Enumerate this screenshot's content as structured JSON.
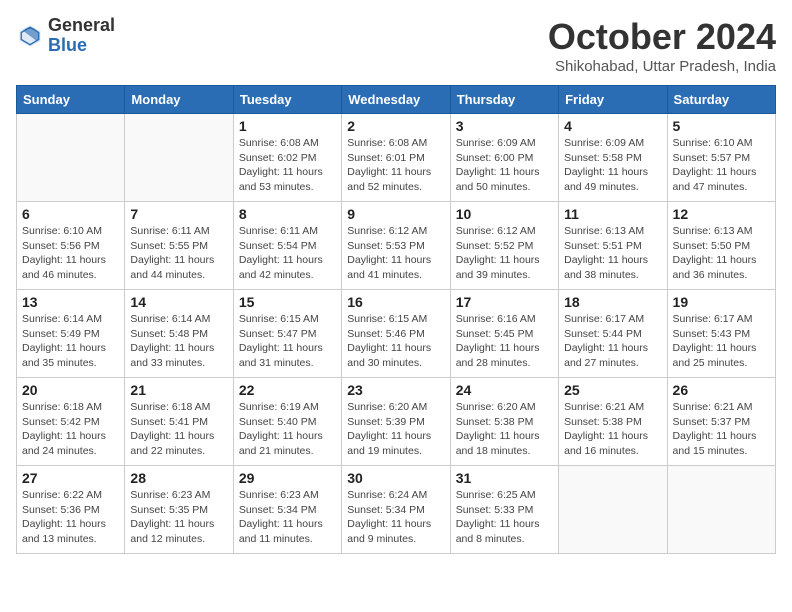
{
  "header": {
    "logo_general": "General",
    "logo_blue": "Blue",
    "month_title": "October 2024",
    "subtitle": "Shikohabad, Uttar Pradesh, India"
  },
  "days_of_week": [
    "Sunday",
    "Monday",
    "Tuesday",
    "Wednesday",
    "Thursday",
    "Friday",
    "Saturday"
  ],
  "weeks": [
    [
      {
        "day": "",
        "info": ""
      },
      {
        "day": "",
        "info": ""
      },
      {
        "day": "1",
        "info": "Sunrise: 6:08 AM\nSunset: 6:02 PM\nDaylight: 11 hours and 53 minutes."
      },
      {
        "day": "2",
        "info": "Sunrise: 6:08 AM\nSunset: 6:01 PM\nDaylight: 11 hours and 52 minutes."
      },
      {
        "day": "3",
        "info": "Sunrise: 6:09 AM\nSunset: 6:00 PM\nDaylight: 11 hours and 50 minutes."
      },
      {
        "day": "4",
        "info": "Sunrise: 6:09 AM\nSunset: 5:58 PM\nDaylight: 11 hours and 49 minutes."
      },
      {
        "day": "5",
        "info": "Sunrise: 6:10 AM\nSunset: 5:57 PM\nDaylight: 11 hours and 47 minutes."
      }
    ],
    [
      {
        "day": "6",
        "info": "Sunrise: 6:10 AM\nSunset: 5:56 PM\nDaylight: 11 hours and 46 minutes."
      },
      {
        "day": "7",
        "info": "Sunrise: 6:11 AM\nSunset: 5:55 PM\nDaylight: 11 hours and 44 minutes."
      },
      {
        "day": "8",
        "info": "Sunrise: 6:11 AM\nSunset: 5:54 PM\nDaylight: 11 hours and 42 minutes."
      },
      {
        "day": "9",
        "info": "Sunrise: 6:12 AM\nSunset: 5:53 PM\nDaylight: 11 hours and 41 minutes."
      },
      {
        "day": "10",
        "info": "Sunrise: 6:12 AM\nSunset: 5:52 PM\nDaylight: 11 hours and 39 minutes."
      },
      {
        "day": "11",
        "info": "Sunrise: 6:13 AM\nSunset: 5:51 PM\nDaylight: 11 hours and 38 minutes."
      },
      {
        "day": "12",
        "info": "Sunrise: 6:13 AM\nSunset: 5:50 PM\nDaylight: 11 hours and 36 minutes."
      }
    ],
    [
      {
        "day": "13",
        "info": "Sunrise: 6:14 AM\nSunset: 5:49 PM\nDaylight: 11 hours and 35 minutes."
      },
      {
        "day": "14",
        "info": "Sunrise: 6:14 AM\nSunset: 5:48 PM\nDaylight: 11 hours and 33 minutes."
      },
      {
        "day": "15",
        "info": "Sunrise: 6:15 AM\nSunset: 5:47 PM\nDaylight: 11 hours and 31 minutes."
      },
      {
        "day": "16",
        "info": "Sunrise: 6:15 AM\nSunset: 5:46 PM\nDaylight: 11 hours and 30 minutes."
      },
      {
        "day": "17",
        "info": "Sunrise: 6:16 AM\nSunset: 5:45 PM\nDaylight: 11 hours and 28 minutes."
      },
      {
        "day": "18",
        "info": "Sunrise: 6:17 AM\nSunset: 5:44 PM\nDaylight: 11 hours and 27 minutes."
      },
      {
        "day": "19",
        "info": "Sunrise: 6:17 AM\nSunset: 5:43 PM\nDaylight: 11 hours and 25 minutes."
      }
    ],
    [
      {
        "day": "20",
        "info": "Sunrise: 6:18 AM\nSunset: 5:42 PM\nDaylight: 11 hours and 24 minutes."
      },
      {
        "day": "21",
        "info": "Sunrise: 6:18 AM\nSunset: 5:41 PM\nDaylight: 11 hours and 22 minutes."
      },
      {
        "day": "22",
        "info": "Sunrise: 6:19 AM\nSunset: 5:40 PM\nDaylight: 11 hours and 21 minutes."
      },
      {
        "day": "23",
        "info": "Sunrise: 6:20 AM\nSunset: 5:39 PM\nDaylight: 11 hours and 19 minutes."
      },
      {
        "day": "24",
        "info": "Sunrise: 6:20 AM\nSunset: 5:38 PM\nDaylight: 11 hours and 18 minutes."
      },
      {
        "day": "25",
        "info": "Sunrise: 6:21 AM\nSunset: 5:38 PM\nDaylight: 11 hours and 16 minutes."
      },
      {
        "day": "26",
        "info": "Sunrise: 6:21 AM\nSunset: 5:37 PM\nDaylight: 11 hours and 15 minutes."
      }
    ],
    [
      {
        "day": "27",
        "info": "Sunrise: 6:22 AM\nSunset: 5:36 PM\nDaylight: 11 hours and 13 minutes."
      },
      {
        "day": "28",
        "info": "Sunrise: 6:23 AM\nSunset: 5:35 PM\nDaylight: 11 hours and 12 minutes."
      },
      {
        "day": "29",
        "info": "Sunrise: 6:23 AM\nSunset: 5:34 PM\nDaylight: 11 hours and 11 minutes."
      },
      {
        "day": "30",
        "info": "Sunrise: 6:24 AM\nSunset: 5:34 PM\nDaylight: 11 hours and 9 minutes."
      },
      {
        "day": "31",
        "info": "Sunrise: 6:25 AM\nSunset: 5:33 PM\nDaylight: 11 hours and 8 minutes."
      },
      {
        "day": "",
        "info": ""
      },
      {
        "day": "",
        "info": ""
      }
    ]
  ]
}
